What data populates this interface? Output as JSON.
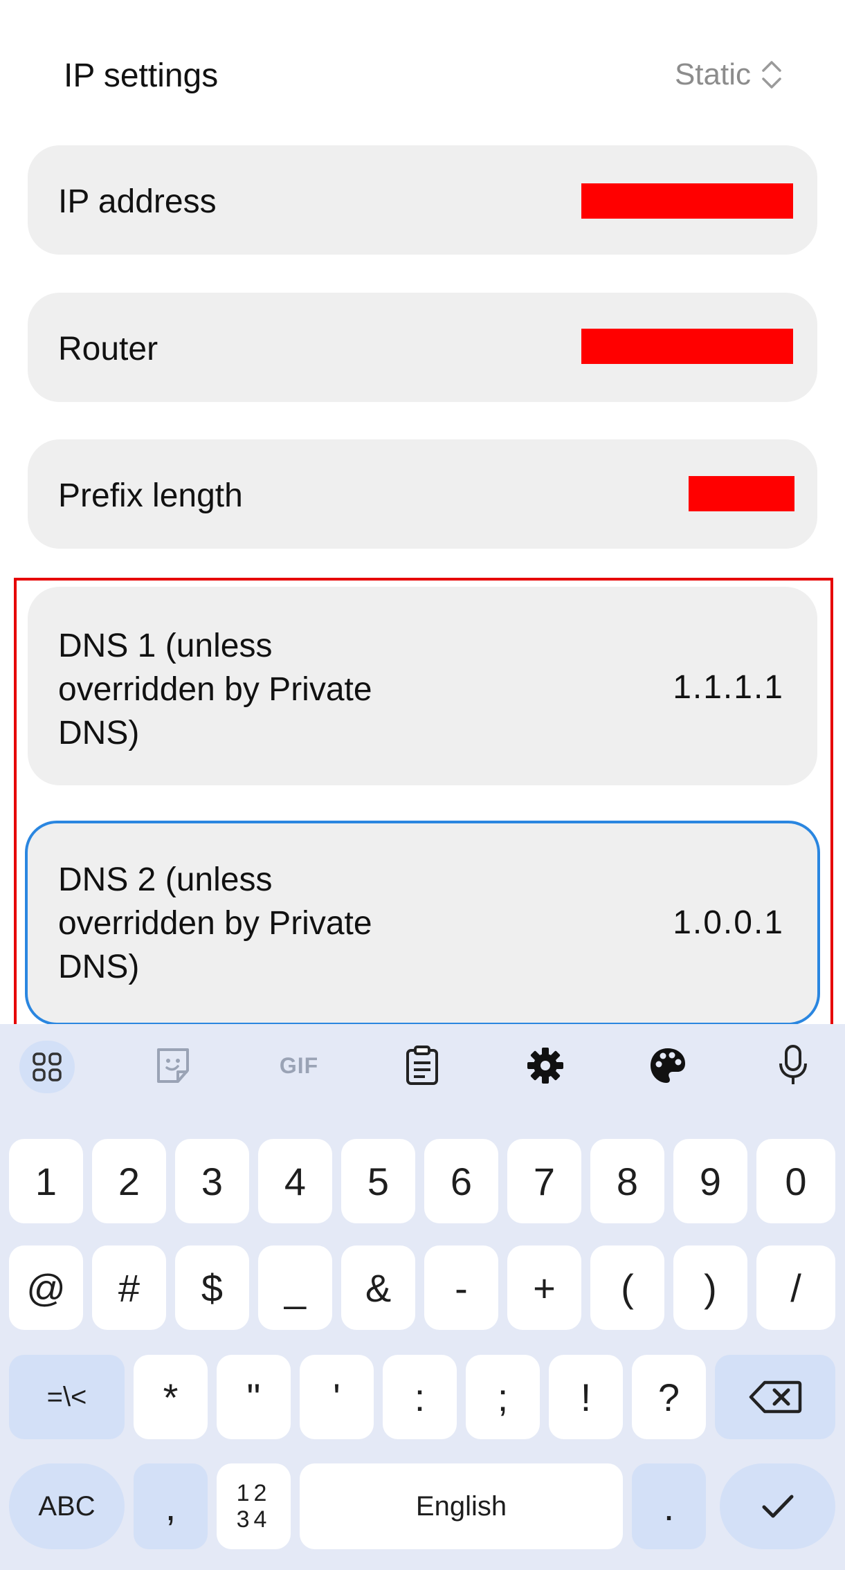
{
  "header": {
    "title": "IP settings",
    "mode_value": "Static"
  },
  "fields": [
    {
      "label": "IP address",
      "value": ""
    },
    {
      "label": "Router",
      "value": ""
    },
    {
      "label": "Prefix length",
      "value": ""
    },
    {
      "label_lines": [
        "DNS 1 (unless",
        "overridden by Private",
        "DNS)"
      ],
      "value": "1.1.1.1"
    },
    {
      "label_lines": [
        "DNS 2 (unless",
        "overridden by Private",
        "DNS)"
      ],
      "value": "1.0.0.1"
    }
  ],
  "colors": {
    "redaction": "#ff0000",
    "highlight": "#e60000",
    "focus": "#2a86e0",
    "keyboard_bg": "#e4e9f6"
  },
  "keyboard": {
    "toolbar": {
      "icons": [
        "apps-grid-icon",
        "sticker-icon",
        "gif-icon",
        "clipboard-icon",
        "gear-icon",
        "palette-icon",
        "microphone-icon"
      ],
      "gif_label": "GIF"
    },
    "row1": [
      "1",
      "2",
      "3",
      "4",
      "5",
      "6",
      "7",
      "8",
      "9",
      "0"
    ],
    "row2": [
      "@",
      "#",
      "$",
      "_",
      "&",
      "-",
      "+",
      "(",
      ")",
      "/"
    ],
    "row3": {
      "shift_label": "=\\<",
      "keys": [
        "*",
        "\"",
        "'",
        ":",
        ";",
        "!",
        "?"
      ]
    },
    "row4": {
      "abc_label": "ABC",
      "comma": ",",
      "numpad_top": "12",
      "numpad_bottom": "34",
      "space_label": "English",
      "period": "."
    }
  }
}
